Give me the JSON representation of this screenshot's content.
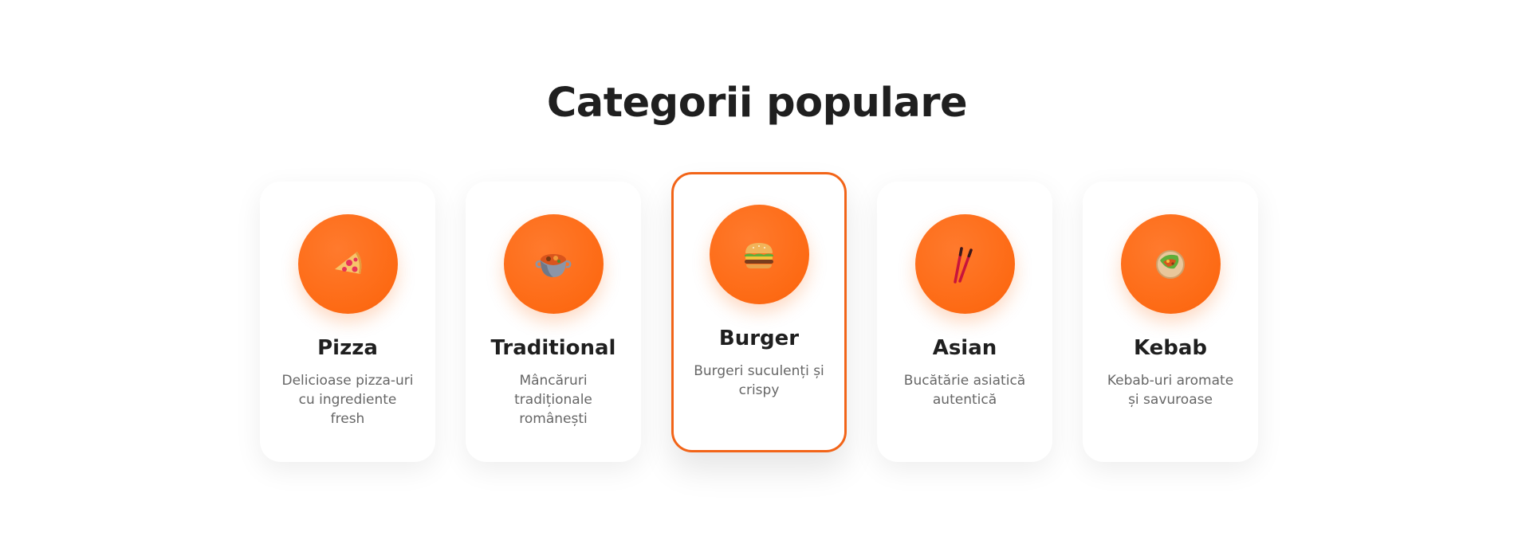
{
  "section": {
    "title": "Categorii populare"
  },
  "colors": {
    "accent": "#fd6a14",
    "active_border": "#f26418",
    "title": "#1f1f1f",
    "description": "#666666"
  },
  "categories": [
    {
      "name": "Pizza",
      "description": "Delicioase pizza-uri cu ingrediente fresh",
      "icon": "pizza-icon",
      "active": false
    },
    {
      "name": "Traditional",
      "description": "Mâncăruri tradiționale românești",
      "icon": "pot-of-food-icon",
      "active": false
    },
    {
      "name": "Burger",
      "description": "Burgeri suculenți și crispy",
      "icon": "burger-icon",
      "active": true
    },
    {
      "name": "Asian",
      "description": "Bucătărie asiatică autentică",
      "icon": "chopsticks-icon",
      "active": false
    },
    {
      "name": "Kebab",
      "description": "Kebab-uri aromate și savuroase",
      "icon": "kebab-icon",
      "active": false
    }
  ]
}
